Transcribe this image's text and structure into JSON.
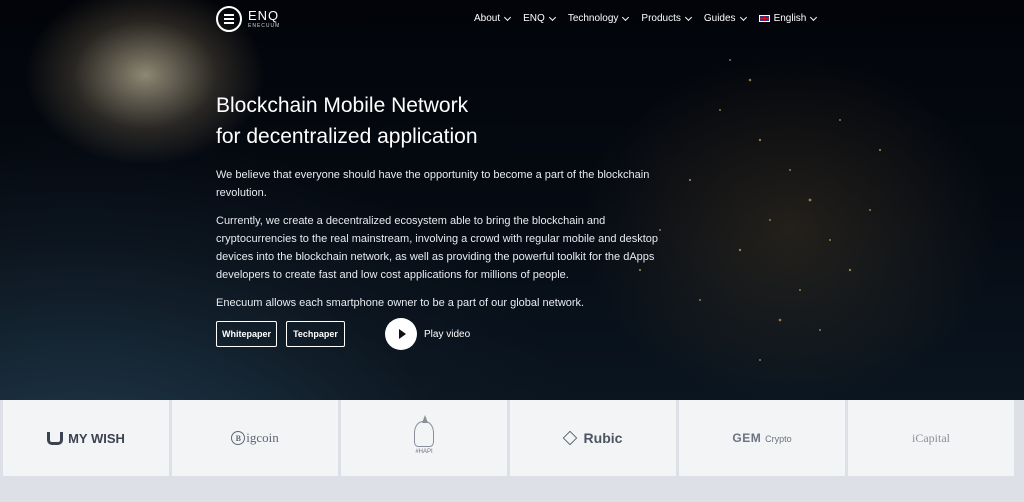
{
  "nav": {
    "logo_name": "ENQ",
    "logo_sub": "ENECUUM",
    "items": [
      {
        "label": "About"
      },
      {
        "label": "ENQ"
      },
      {
        "label": "Technology"
      },
      {
        "label": "Products"
      },
      {
        "label": "Guides"
      }
    ],
    "language": "English"
  },
  "hero": {
    "title_line1": "Blockchain Mobile Network",
    "title_line2": "for decentralized application",
    "paragraphs": [
      "We believe that everyone should have the opportunity to become a part of the blockchain revolution.",
      "Currently, we create a decentralized ecosystem able to bring the blockchain and cryptocurrencies to the real mainstream, involving a crowd with regular mobile and desktop devices into the blockchain network, as well as providing the powerful toolkit for the dApps developers to create fast and low cost applications for millions of people.",
      "Enecuum allows each smartphone owner to be a part of our global network."
    ],
    "whitepaper_label": "Whitepaper",
    "techpaper_label": "Techpaper",
    "play_label": "Play video"
  },
  "partners": [
    {
      "name": "MY WISH",
      "icon": "mywish-logo-icon"
    },
    {
      "name": "igcoin",
      "sub": "B",
      "icon": "bigcoin-logo-icon"
    },
    {
      "name": "#HAPI",
      "icon": "hapi-unicorn-icon"
    },
    {
      "name": "Rubic",
      "icon": "rubic-cube-icon"
    },
    {
      "name": "GEM",
      "sub": "Crypto",
      "icon": "gem-crypto-logo-icon"
    },
    {
      "name": "iCapital",
      "icon": "icapital-logo-icon"
    }
  ]
}
